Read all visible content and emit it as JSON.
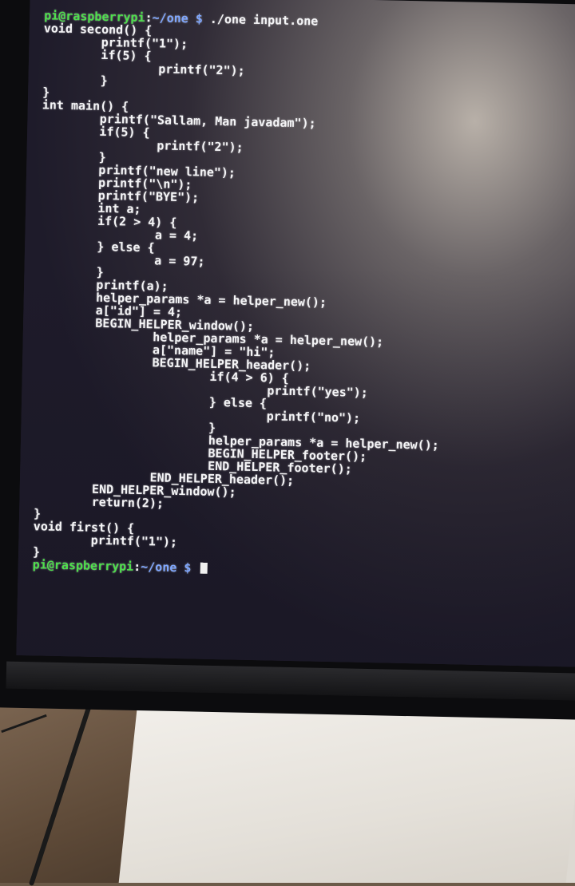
{
  "terminal": {
    "prompt_user": "pi@raspberrypi",
    "prompt_sep": ":",
    "prompt_path": "~/one",
    "prompt_symbol": "$",
    "command": "./one input.one",
    "output_lines": [
      "void second() {",
      "        printf(\"1\");",
      "        if(5) {",
      "                printf(\"2\");",
      "        }",
      "}",
      "int main() {",
      "        printf(\"Sallam, Man javadam\");",
      "        if(5) {",
      "                printf(\"2\");",
      "        }",
      "        printf(\"new line\");",
      "        printf(\"\\n\");",
      "        printf(\"BYE\");",
      "        int a;",
      "        if(2 > 4) {",
      "                a = 4;",
      "        } else {",
      "                a = 97;",
      "        }",
      "        printf(a);",
      "        helper_params *a = helper_new();",
      "        a[\"id\"] = 4;",
      "        BEGIN_HELPER_window();",
      "                helper_params *a = helper_new();",
      "                a[\"name\"] = \"hi\";",
      "                BEGIN_HELPER_header();",
      "                        if(4 > 6) {",
      "                                printf(\"yes\");",
      "                        } else {",
      "                                printf(\"no\");",
      "                        }",
      "                        helper_params *a = helper_new();",
      "                        BEGIN_HELPER_footer();",
      "                        END_HELPER_footer();",
      "                END_HELPER_header();",
      "        END_HELPER_window();",
      "        return(2);",
      "}",
      "void first() {",
      "        printf(\"1\");",
      "}"
    ]
  },
  "colors": {
    "prompt_user": "#4ee04c",
    "prompt_path": "#7fa7ff",
    "text": "#f4f4f6"
  }
}
